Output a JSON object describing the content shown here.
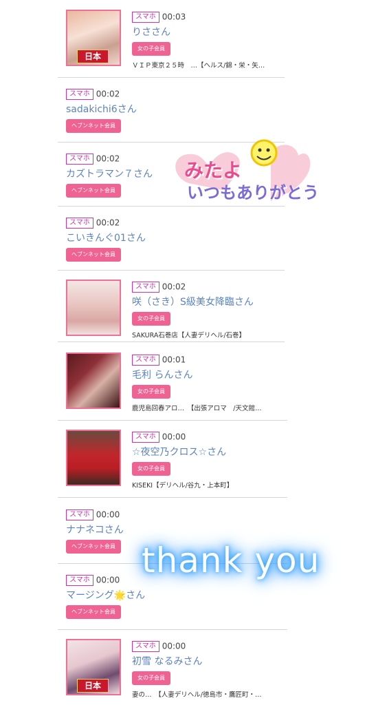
{
  "labels": {
    "device": "スマホ",
    "girl_member": "女の子会員",
    "heaven_member": "ヘブンネット会員"
  },
  "visitors": [
    {
      "time": "00:03",
      "name": "りささん",
      "member": "女の子会員",
      "shop": "ＶＩＰ東京２５時　…【ヘルス/錦・栄・矢…"
    },
    {
      "time": "00:02",
      "name": "sadakichi6さん",
      "member": "ヘブンネット会員",
      "shop": ""
    },
    {
      "time": "00:02",
      "name": "カズトラマン７さん",
      "member": "ヘブンネット会員",
      "shop": ""
    },
    {
      "time": "00:02",
      "name": "こいきんぐ01さん",
      "member": "ヘブンネット会員",
      "shop": ""
    },
    {
      "time": "00:02",
      "name": "咲（さき）S級美女降臨さん",
      "member": "女の子会員",
      "shop": "SAKURA石巻店【人妻デリヘル/石巻】"
    },
    {
      "time": "00:01",
      "name": "毛利 らんさん",
      "member": "女の子会員",
      "shop": "鹿児島回春アロ…　【出張アロマ　/天文館…"
    },
    {
      "time": "00:00",
      "name": "☆夜空乃クロス☆さん",
      "member": "女の子会員",
      "shop": "KISEKI【デリヘル/谷九・上本町】"
    },
    {
      "time": "00:00",
      "name": "ナナネコさん",
      "member": "ヘブンネット会員",
      "shop": ""
    },
    {
      "time": "00:00",
      "name": "マージング🌟さん",
      "member": "ヘブンネット会員",
      "shop": ""
    },
    {
      "time": "00:00",
      "name": "初雪 なるみさん",
      "member": "女の子会員",
      "shop": "妻の…　【人妻デリヘル/徳島市・鷹匠町・…"
    }
  ],
  "thumb_badges": [
    "日本",
    "日本"
  ],
  "stickers": {
    "mitayo_line1": "みたよ",
    "mitayo_line2": "いつもありがとう",
    "thank_you": "thank you"
  },
  "colors": {
    "accent_pink": "#f06292",
    "tag_magenta": "#d02fae",
    "name_blue": "#5c82c6",
    "thumb_border": "#ef6f97"
  }
}
